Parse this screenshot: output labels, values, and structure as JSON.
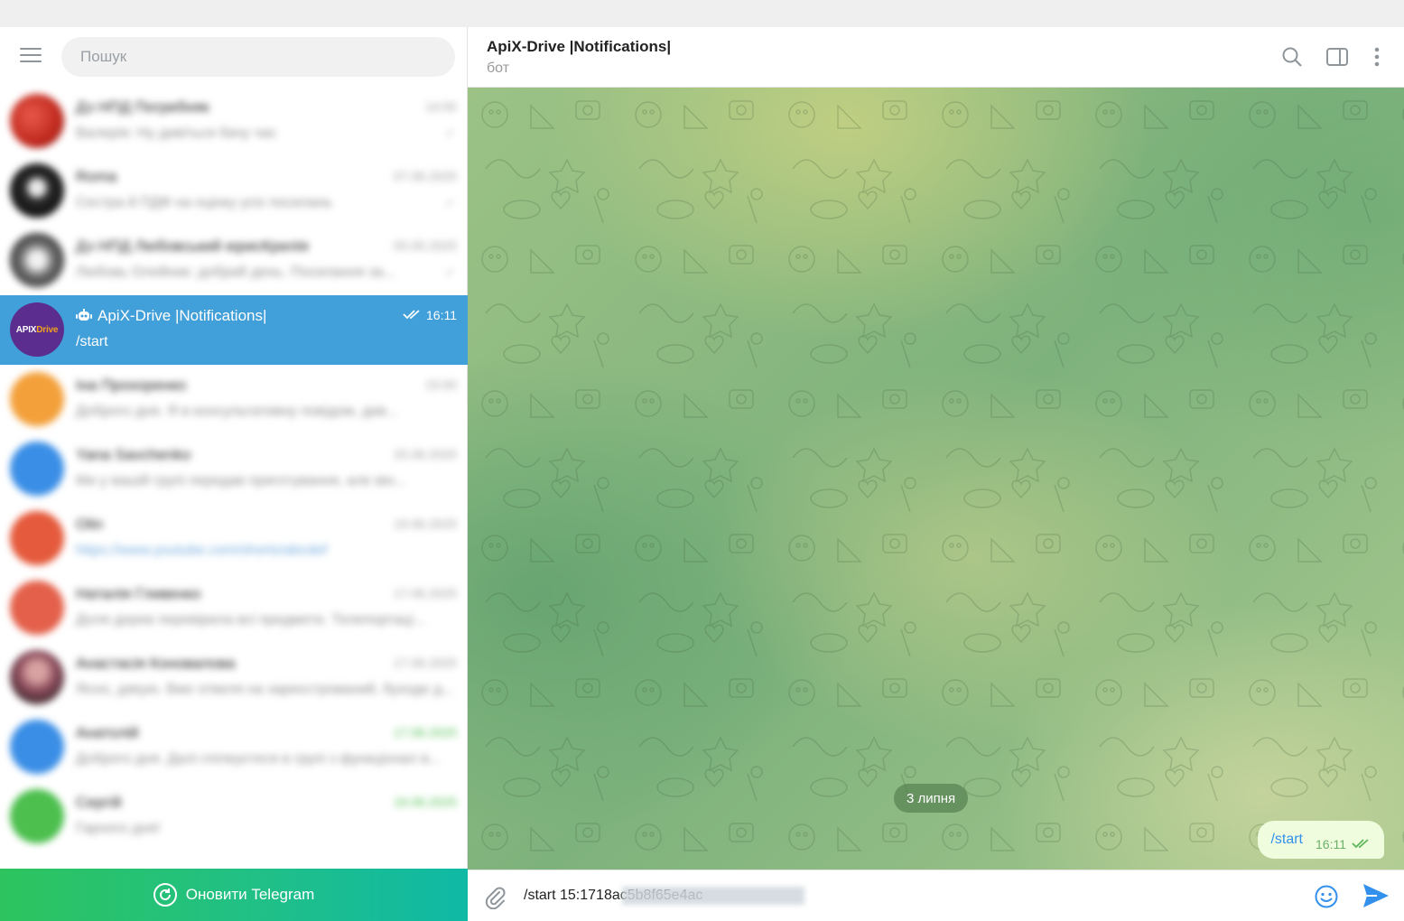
{
  "sidebar": {
    "search_placeholder": "Пошук",
    "chats": [
      {
        "name": "Дз НПД Погребняк",
        "preview": "Валерія: Ну дивіться бачу час",
        "time": "14:00",
        "avatar_color": "#c0281d"
      },
      {
        "name": "Roma",
        "preview": "Сестра й ПДФ на оцінку усіх посилань",
        "time": "07.06.2025",
        "avatar_color": "#2b2b2b"
      },
      {
        "name": "Дз НПД Любовський юрисКрилія",
        "preview": "Любовь Олейник: добрий день. Посилання за...",
        "time": "05.05.2025",
        "avatar_color": "#6d6d6d"
      },
      {
        "name": "ApiX-Drive |Notifications|",
        "preview": "/start",
        "time": "16:11",
        "avatar_color": "#5b2d8e",
        "active": true
      },
      {
        "name": "Іна Прохоренко",
        "preview": "Доброго дня. Я в консультативну повідом, див...",
        "time": "15:00",
        "avatar_color": "#f3a03a"
      },
      {
        "name": "Yana Savchenko",
        "preview": "Ми у вашій групі передав приготування, але він...",
        "time": "25.06.2025",
        "avatar_color": "#3a8ee6"
      },
      {
        "name": "Olin",
        "preview": "https://www.youtube.com/shorts/abcdef",
        "time": "19.06.2025",
        "avatar_color": "#e55a3c"
      },
      {
        "name": "Наталія Гливенко",
        "preview": "Доля дерев перевірила всі предмети. Телепортаці...",
        "time": "17.06.2025",
        "avatar_color": "#e4604a"
      },
      {
        "name": "Анастасія Коновалова",
        "preview": "Ясно, дякую. Вже отвеля на зареєстрований, буходе д...",
        "time": "17.06.2025",
        "avatar_color": "#8a4a5a"
      },
      {
        "name": "Анатолій",
        "preview": "Доброго дня. Далі спілкуєтеся в групі з функціонал в...",
        "time": "17.06.2025",
        "avatar_color": "#3a8ee6"
      },
      {
        "name": "Сергій",
        "preview": "Гарного дня!",
        "time": "16.06.2025",
        "avatar_color": "#4cbf4e"
      }
    ],
    "update_label": "Оновити Telegram"
  },
  "chat": {
    "title": "ApiX-Drive |Notifications|",
    "subtitle": "бот",
    "date_label": "3 липня",
    "messages": [
      {
        "text": "/start",
        "time": "16:11"
      }
    ],
    "input_value": "/start 15:1718ac5b8f65e4ac",
    "apix_logo": {
      "part1": "APIX",
      "part2": "Drive"
    }
  },
  "colors": {
    "active_chat": "#419fd9",
    "update_bar_start": "#2dc45e",
    "update_bar_end": "#0fb9a5",
    "outgoing_bubble": "#effdde"
  },
  "icons": [
    "menu-icon",
    "search-icon",
    "sidebar-toggle-icon",
    "more-icon",
    "attach-icon",
    "emoji-icon",
    "send-icon",
    "bot-icon",
    "double-check-icon",
    "update-icon"
  ]
}
